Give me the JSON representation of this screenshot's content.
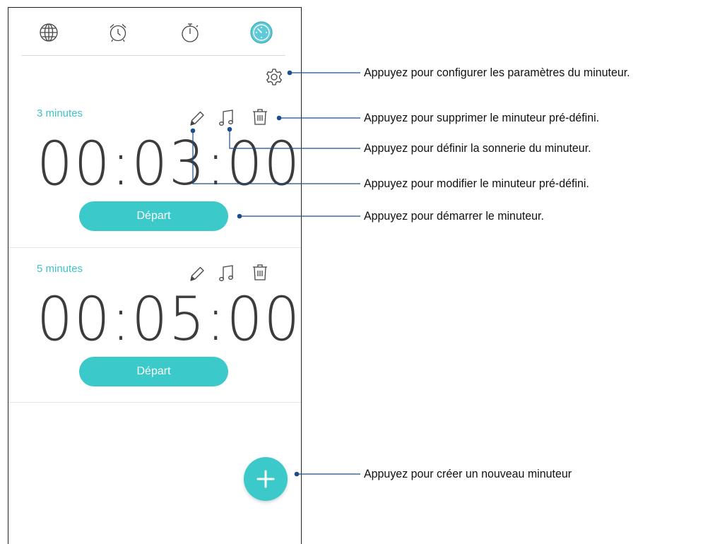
{
  "timers": [
    {
      "label": "3 minutes",
      "time": "00:03:00",
      "start_label": "Départ"
    },
    {
      "label": "5 minutes",
      "time": "00:05:00",
      "start_label": "Départ"
    }
  ],
  "tabs": [
    {
      "icon": "globe-icon",
      "name": "world-clock"
    },
    {
      "icon": "alarm-clock-icon",
      "name": "alarm"
    },
    {
      "icon": "stopwatch-icon",
      "name": "stopwatch"
    },
    {
      "icon": "timer-icon",
      "name": "timer",
      "active": true
    }
  ],
  "callouts": {
    "settings": "Appuyez pour configurer les paramètres du minuteur.",
    "delete": "Appuyez pour supprimer le minuteur pré-défini.",
    "ringtone": "Appuyez pour définir la sonnerie du minuteur.",
    "edit": "Appuyez pour modifier le minuteur pré-défini.",
    "start": "Appuyez pour démarrer le minuteur.",
    "add": "Appuyez pour créer un nouveau minuteur"
  },
  "colors": {
    "accent": "#3cc9ca",
    "label": "#3cc3c9",
    "callout_line": "#1a4e8c",
    "icon": "#444444"
  }
}
